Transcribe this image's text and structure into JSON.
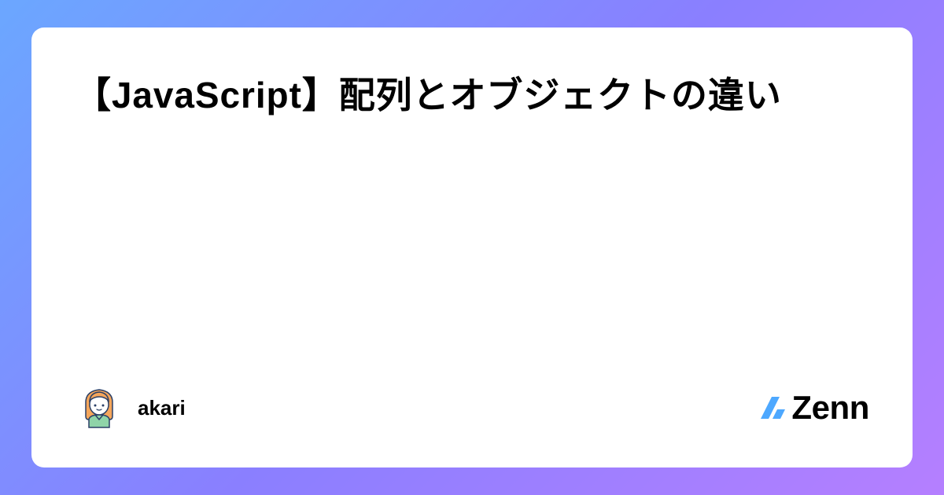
{
  "article": {
    "title": "【JavaScript】配列とオブジェクトの違い"
  },
  "author": {
    "name": "akari"
  },
  "platform": {
    "name": "Zenn"
  }
}
